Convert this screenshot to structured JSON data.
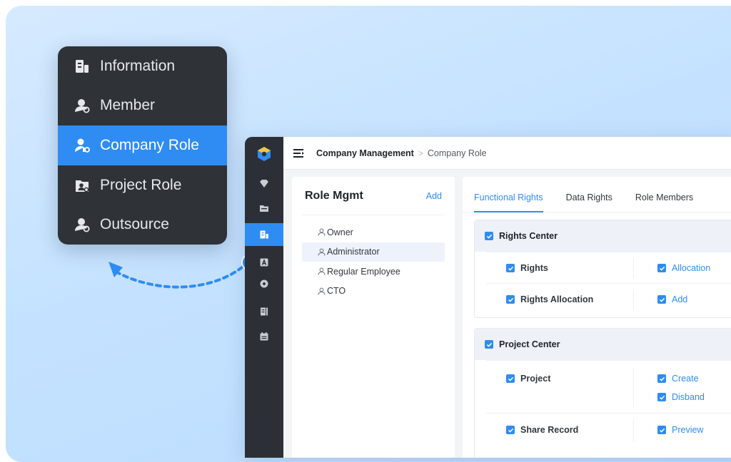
{
  "popup_menu": {
    "items": [
      {
        "label": "Information",
        "icon": "building-icon",
        "active": false
      },
      {
        "label": "Member",
        "icon": "member-icon",
        "active": false
      },
      {
        "label": "Company Role",
        "icon": "company-role-icon",
        "active": true
      },
      {
        "label": "Project Role",
        "icon": "project-role-icon",
        "active": false
      },
      {
        "label": "Outsource",
        "icon": "outsource-icon",
        "active": false
      }
    ]
  },
  "colors": {
    "accent": "#2f8cf3",
    "rail_bg": "#2c3036",
    "popup_bg": "#2f3338",
    "background": "#c4e2ff"
  },
  "rail": {
    "icons": [
      "app-logo-icon",
      "diamond-icon",
      "folder-icon",
      "company-icon",
      "contact-card-icon",
      "settings-icon",
      "document-icon",
      "calendar-icon"
    ],
    "active_index": 2
  },
  "header": {
    "breadcrumb_root": "Company Management",
    "breadcrumb_separator": ">",
    "breadcrumb_current": "Company Role"
  },
  "role_mgmt": {
    "title": "Role Mgmt",
    "add_label": "Add",
    "roles": [
      {
        "label": "Owner",
        "selected": false
      },
      {
        "label": "Administrator",
        "selected": true
      },
      {
        "label": "Regular Employee",
        "selected": false
      },
      {
        "label": "CTO",
        "selected": false
      }
    ]
  },
  "rights": {
    "tabs": [
      {
        "label": "Functional Rights",
        "active": true
      },
      {
        "label": "Data Rights",
        "active": false
      },
      {
        "label": "Role Members",
        "active": false
      }
    ],
    "groups": [
      {
        "title": "Rights Center",
        "rows": [
          {
            "left": "Rights",
            "right": [
              "Allocation"
            ]
          },
          {
            "left": "Rights Allocation",
            "right": [
              "Add"
            ]
          }
        ]
      },
      {
        "title": "Project Center",
        "rows": [
          {
            "left": "Project",
            "right": [
              "Create",
              "Disband"
            ]
          },
          {
            "left": "Share Record",
            "right": [
              "Preview"
            ]
          }
        ]
      }
    ]
  }
}
